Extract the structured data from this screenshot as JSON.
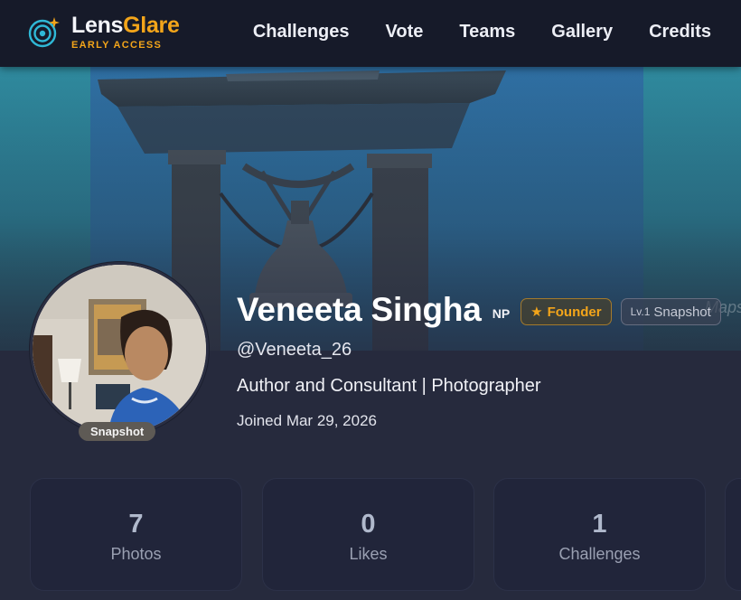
{
  "brand": {
    "name_part1": "Lens",
    "name_part2": "Glare",
    "tagline": "EARLY ACCESS",
    "icon": "target-sparkle-icon",
    "accent_color": "#f3a51a"
  },
  "nav": {
    "items": [
      {
        "label": "Challenges"
      },
      {
        "label": "Vote"
      },
      {
        "label": "Teams"
      },
      {
        "label": "Gallery"
      },
      {
        "label": "Credits"
      }
    ]
  },
  "cover": {
    "watermark": "Maps"
  },
  "profile": {
    "name": "Veneeta Singha",
    "country_code": "NP",
    "founder_badge": "Founder",
    "founder_icon": "star-icon",
    "level_prefix": "Lv.1",
    "level_name": "Snapshot",
    "avatar_badge": "Snapshot",
    "handle": "@Veneeta_26",
    "bio": "Author and Consultant | Photographer",
    "joined": "Joined Mar 29, 2026"
  },
  "stats": [
    {
      "value": "7",
      "label": "Photos"
    },
    {
      "value": "0",
      "label": "Likes"
    },
    {
      "value": "1",
      "label": "Challenges"
    }
  ]
}
